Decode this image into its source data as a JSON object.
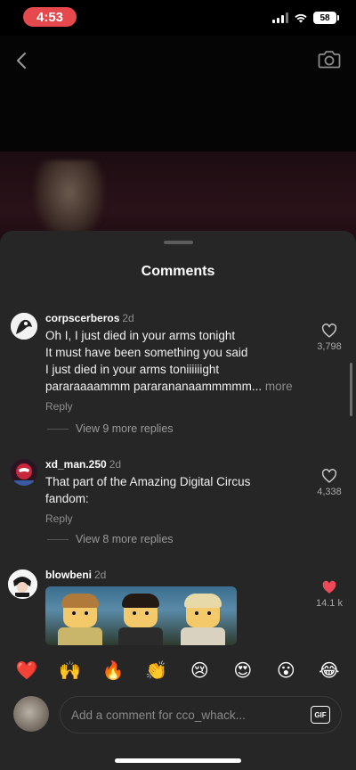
{
  "status_bar": {
    "time": "4:53",
    "battery": "58"
  },
  "header": {
    "back_icon": "chevron-left-icon",
    "camera_icon": "camera-icon"
  },
  "sheet": {
    "title": "Comments"
  },
  "comments": [
    {
      "username": "corpscerberos",
      "age": "2d",
      "lines": [
        "Oh I, I just died in your arms tonight",
        "It must have been something you said",
        "I just died in your arms toniiiiiight",
        "pararaaaammm pararananaammmmm..."
      ],
      "more": "more",
      "reply_label": "Reply",
      "likes": "3,798",
      "liked": false,
      "view_replies": "View 9 more replies"
    },
    {
      "username": "xd_man.250",
      "age": "2d",
      "lines": [
        "That part of the Amazing Digital Circus",
        "fandom:"
      ],
      "reply_label": "Reply",
      "likes": "4,338",
      "liked": false,
      "view_replies": "View 8 more replies"
    },
    {
      "username": "blowbeni",
      "age": "2d",
      "likes": "14.1 k",
      "liked": true,
      "has_gif": true
    }
  ],
  "reactions": [
    {
      "emoji": "❤️",
      "name": "heart"
    },
    {
      "emoji": "🙌",
      "name": "raised-hands"
    },
    {
      "emoji": "🔥",
      "name": "fire"
    },
    {
      "emoji": "👏",
      "name": "clapping-hands"
    },
    {
      "emoji": "😢",
      "name": "crying-face"
    },
    {
      "emoji": "😍",
      "name": "heart-eyes"
    },
    {
      "emoji": "😮",
      "name": "open-mouth"
    },
    {
      "emoji": "😂",
      "name": "tears-of-joy"
    }
  ],
  "composer": {
    "placeholder": "Add a comment for cco_whack...",
    "gif_label": "GIF"
  },
  "colors": {
    "sheet_bg": "#262626",
    "time_pill": "#e5484d",
    "liked_heart": "#ed4956",
    "secondary_text": "#8e8e8e"
  }
}
